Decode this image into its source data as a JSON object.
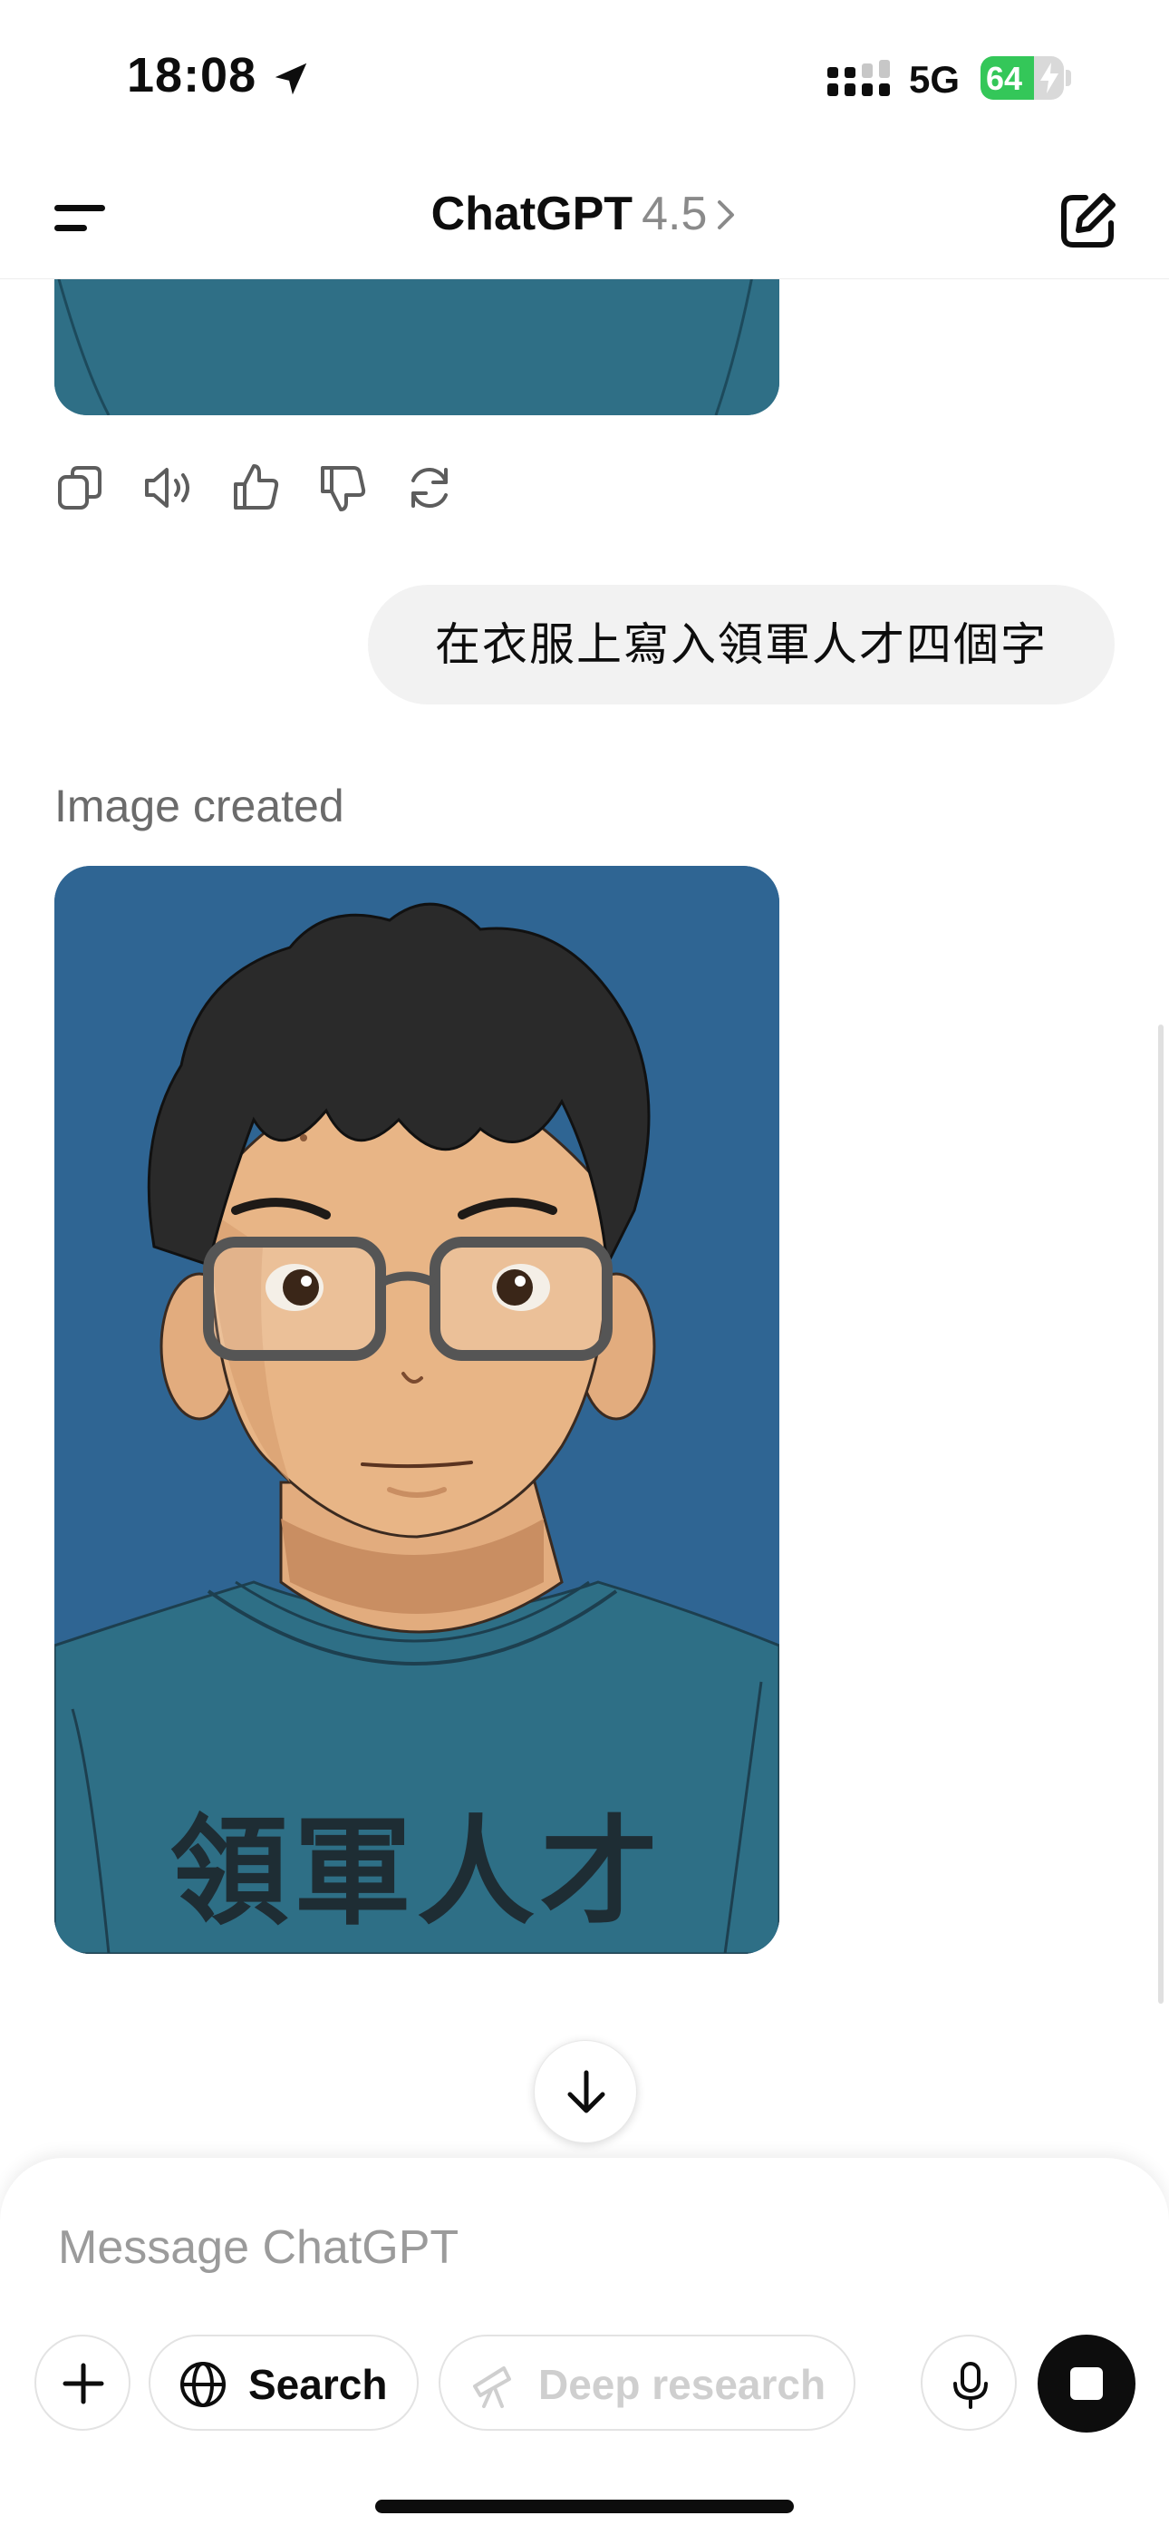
{
  "status_bar": {
    "time": "18:08",
    "network": "5G",
    "battery": "64",
    "battery_level": 0.64,
    "icons": [
      "location-arrow-icon",
      "signal-icon",
      "battery-icon",
      "charging-bolt-icon"
    ]
  },
  "header": {
    "title": "ChatGPT",
    "version": "4.5",
    "icons": [
      "menu-icon",
      "chevron-right-icon",
      "new-chat-icon"
    ]
  },
  "message_actions": [
    "copy-icon",
    "read-aloud-icon",
    "thumbs-up-icon",
    "thumbs-down-icon",
    "regenerate-icon"
  ],
  "conversation": {
    "user_message": "在衣服上寫入領軍人才四個字",
    "assistant_label": "Image created",
    "image_shirt_text": "領軍人才"
  },
  "composer": {
    "placeholder": "Message ChatGPT",
    "search_label": "Search",
    "deep_research_label": "Deep research",
    "icons": [
      "plus-icon",
      "globe-icon",
      "telescope-icon",
      "microphone-icon",
      "stop-icon"
    ]
  },
  "colors": {
    "accent": "#0d0d0d",
    "battery_green": "#34c759",
    "bubble": "#f2f2f2",
    "image_bg": "#2f6593",
    "shirt": "#2f6f86"
  }
}
